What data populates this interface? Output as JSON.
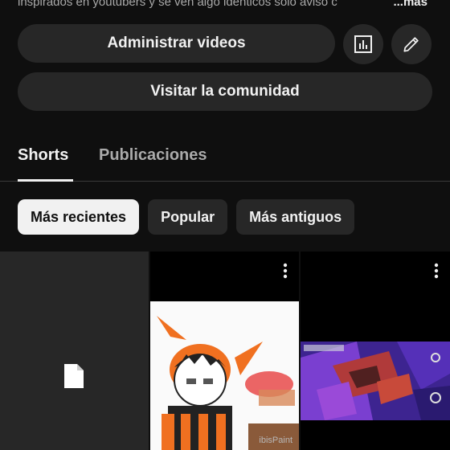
{
  "description": {
    "text": "inspirados en youtubers y se ven algo identicos solo aviso c",
    "more_label": "...más"
  },
  "actions": {
    "manage_label": "Administrar videos",
    "visit_label": "Visitar la comunidad",
    "stats_icon": "bar-chart-icon",
    "edit_icon": "pencil-icon"
  },
  "tabs": [
    {
      "label": "Shorts",
      "active": true
    },
    {
      "label": "Publicaciones",
      "active": false
    }
  ],
  "filters": [
    {
      "label": "Más recientes",
      "active": true
    },
    {
      "label": "Popular",
      "active": false
    },
    {
      "label": "Más antiguos",
      "active": false
    }
  ],
  "shorts": {
    "placeholder_icon": "document-icon",
    "menu_icon": "more-vert-icon",
    "watermark": "ibisPaint"
  },
  "colors": {
    "background": "#0f0f0f",
    "surface": "#272727",
    "text_primary": "#f1f1f1",
    "text_secondary": "#aaaaaa",
    "active_chip": "#f1f1f1"
  }
}
